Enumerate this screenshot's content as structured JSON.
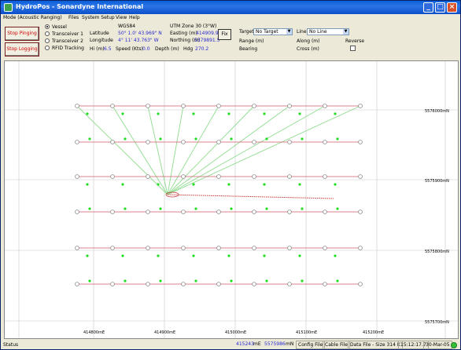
{
  "window": {
    "title": "HydroPos - Sonardyne International"
  },
  "menu": [
    "Mode (Acoustic Ranging)",
    "Files",
    "System Setup",
    "View",
    "Help"
  ],
  "buttons": {
    "stop_pinging": "Stop Pinging",
    "stop_logging": "Stop Logging",
    "fix": "Fix"
  },
  "radios": [
    {
      "label": "Vessel",
      "selected": true
    },
    {
      "label": "Transceiver 1",
      "selected": false
    },
    {
      "label": "Transceiver 2",
      "selected": false
    },
    {
      "label": "RFID Tracking",
      "selected": false
    }
  ],
  "geo": {
    "datum": "WGS84",
    "latitude_label": "Latitude",
    "latitude": "50° 1.0' 43.969\" N",
    "longitude_label": "Longitude",
    "longitude": "4° 11' 43.763\" W",
    "hi_label": "Hi (m)",
    "hi": "6.5",
    "speed_label": "Speed (Kts)",
    "speed": "0.0",
    "depth_label": "Depth (m)"
  },
  "utm": {
    "zone": "UTM Zone 30 (3°W)",
    "easting_label": "Easting (m)",
    "easting": "414909.9",
    "northing_label": "Northing (m)",
    "northing": "5579891.5",
    "hdg_label": "Hdg",
    "hdg": "270.2"
  },
  "target": {
    "target_label": "Target",
    "target_value": "No Target",
    "range_label": "Range (m)",
    "bearing_label": "Bearing",
    "line_label": "Line",
    "line_value": "No Line",
    "along_label": "Along (m)",
    "cross_label": "Cross (m)",
    "reverse_label": "Reverse"
  },
  "plot": {
    "x_ticks": [
      "414800mE",
      "414900mE",
      "415000mE",
      "415100mE",
      "415200mE"
    ],
    "y_ticks": [
      "5576000mN",
      "5575900mN",
      "5575800mN",
      "5575700mN"
    ]
  },
  "status": {
    "text": "Status",
    "easting": "415243",
    "easting_unit": "mE",
    "northing": "5575986",
    "northing_unit": "mN",
    "config": "Config File",
    "cable": "Cable File",
    "datafile": "Data File - Size 314 K",
    "time": "15:12:17.7",
    "date": "30-Mar-05"
  },
  "colors": {
    "grid_line": "#d25a6a",
    "marker_ring": "#888888",
    "ray": "#8fdc8f",
    "dot": "#22dd22",
    "track": "#c93a3a"
  }
}
